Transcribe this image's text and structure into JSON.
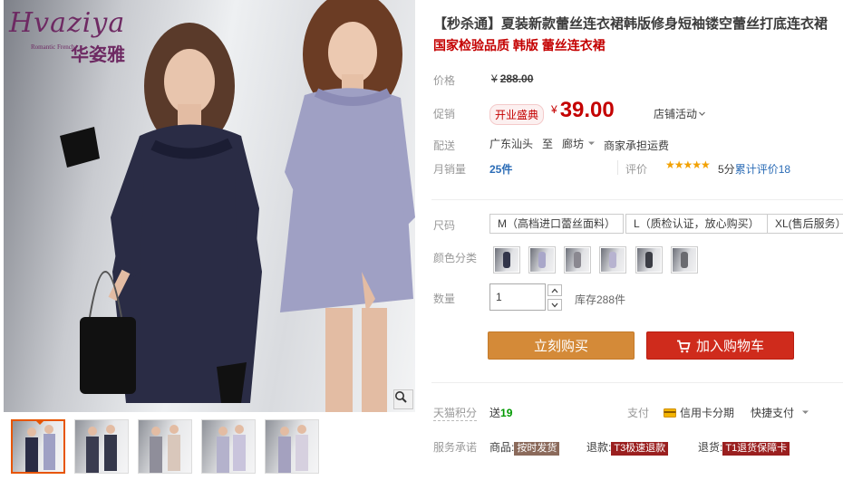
{
  "gallery": {
    "brand_script": "Hvaziya",
    "brand_sub": "Romantic French",
    "brand_cn": "华姿雅",
    "zoom_icon": "magnifier-icon",
    "thumbnail_count": 5,
    "active_thumbnail": 1
  },
  "product": {
    "title": "【秒杀通】夏装新款蕾丝连衣裙韩版修身短袖镂空蕾丝打底连衣裙",
    "subtitle": "国家检验品质 韩版 蕾丝连衣裙"
  },
  "price": {
    "label": "价格",
    "currency": "¥",
    "original": "288.00",
    "promo_label": "促销",
    "promo_badge": "开业盛典",
    "promo_price": "39.00",
    "store_activity": "店铺活动"
  },
  "shipping": {
    "label": "配送",
    "from": "广东汕头",
    "to_word": "至",
    "to": "廊坊",
    "note": "商家承担运费"
  },
  "sales": {
    "label": "月销量",
    "count": "25件",
    "review_label": "评价",
    "stars": "★★★★★",
    "review_text_prefix": "5分",
    "review_text": "累计评价",
    "review_count": "18"
  },
  "size": {
    "label": "尺码",
    "options": [
      "M（高档进口蕾丝面料）",
      "L（质检认证，放心购买）",
      "XL(售后服务）"
    ]
  },
  "color": {
    "label": "颜色分类",
    "swatch_colors": [
      "#33364a",
      "#a9a7c9",
      "#8a8890",
      "#b7b3d0",
      "#3b3d45",
      "#6a6b70"
    ]
  },
  "quantity": {
    "label": "数量",
    "value": "1",
    "stock": "库存288件"
  },
  "buttons": {
    "buy_now": "立刻购买",
    "add_cart": "加入购物车"
  },
  "points": {
    "label": "天猫积分",
    "send_word": "送",
    "value": "19",
    "pay_label": "支付",
    "credit": "信用卡分期",
    "quick_pay": "快捷支付"
  },
  "service": {
    "label": "服务承诺",
    "goods_label": "商品:",
    "goods_tag": "按时发货",
    "refund_label": "退款:",
    "refund_tag": "T3极速退款",
    "return_label": "退货:",
    "return_tag": "T1退货保障卡"
  },
  "colors": {
    "accent_red": "#c40000",
    "buy_orange": "#d48a38",
    "cart_red": "#cf2b1c"
  }
}
